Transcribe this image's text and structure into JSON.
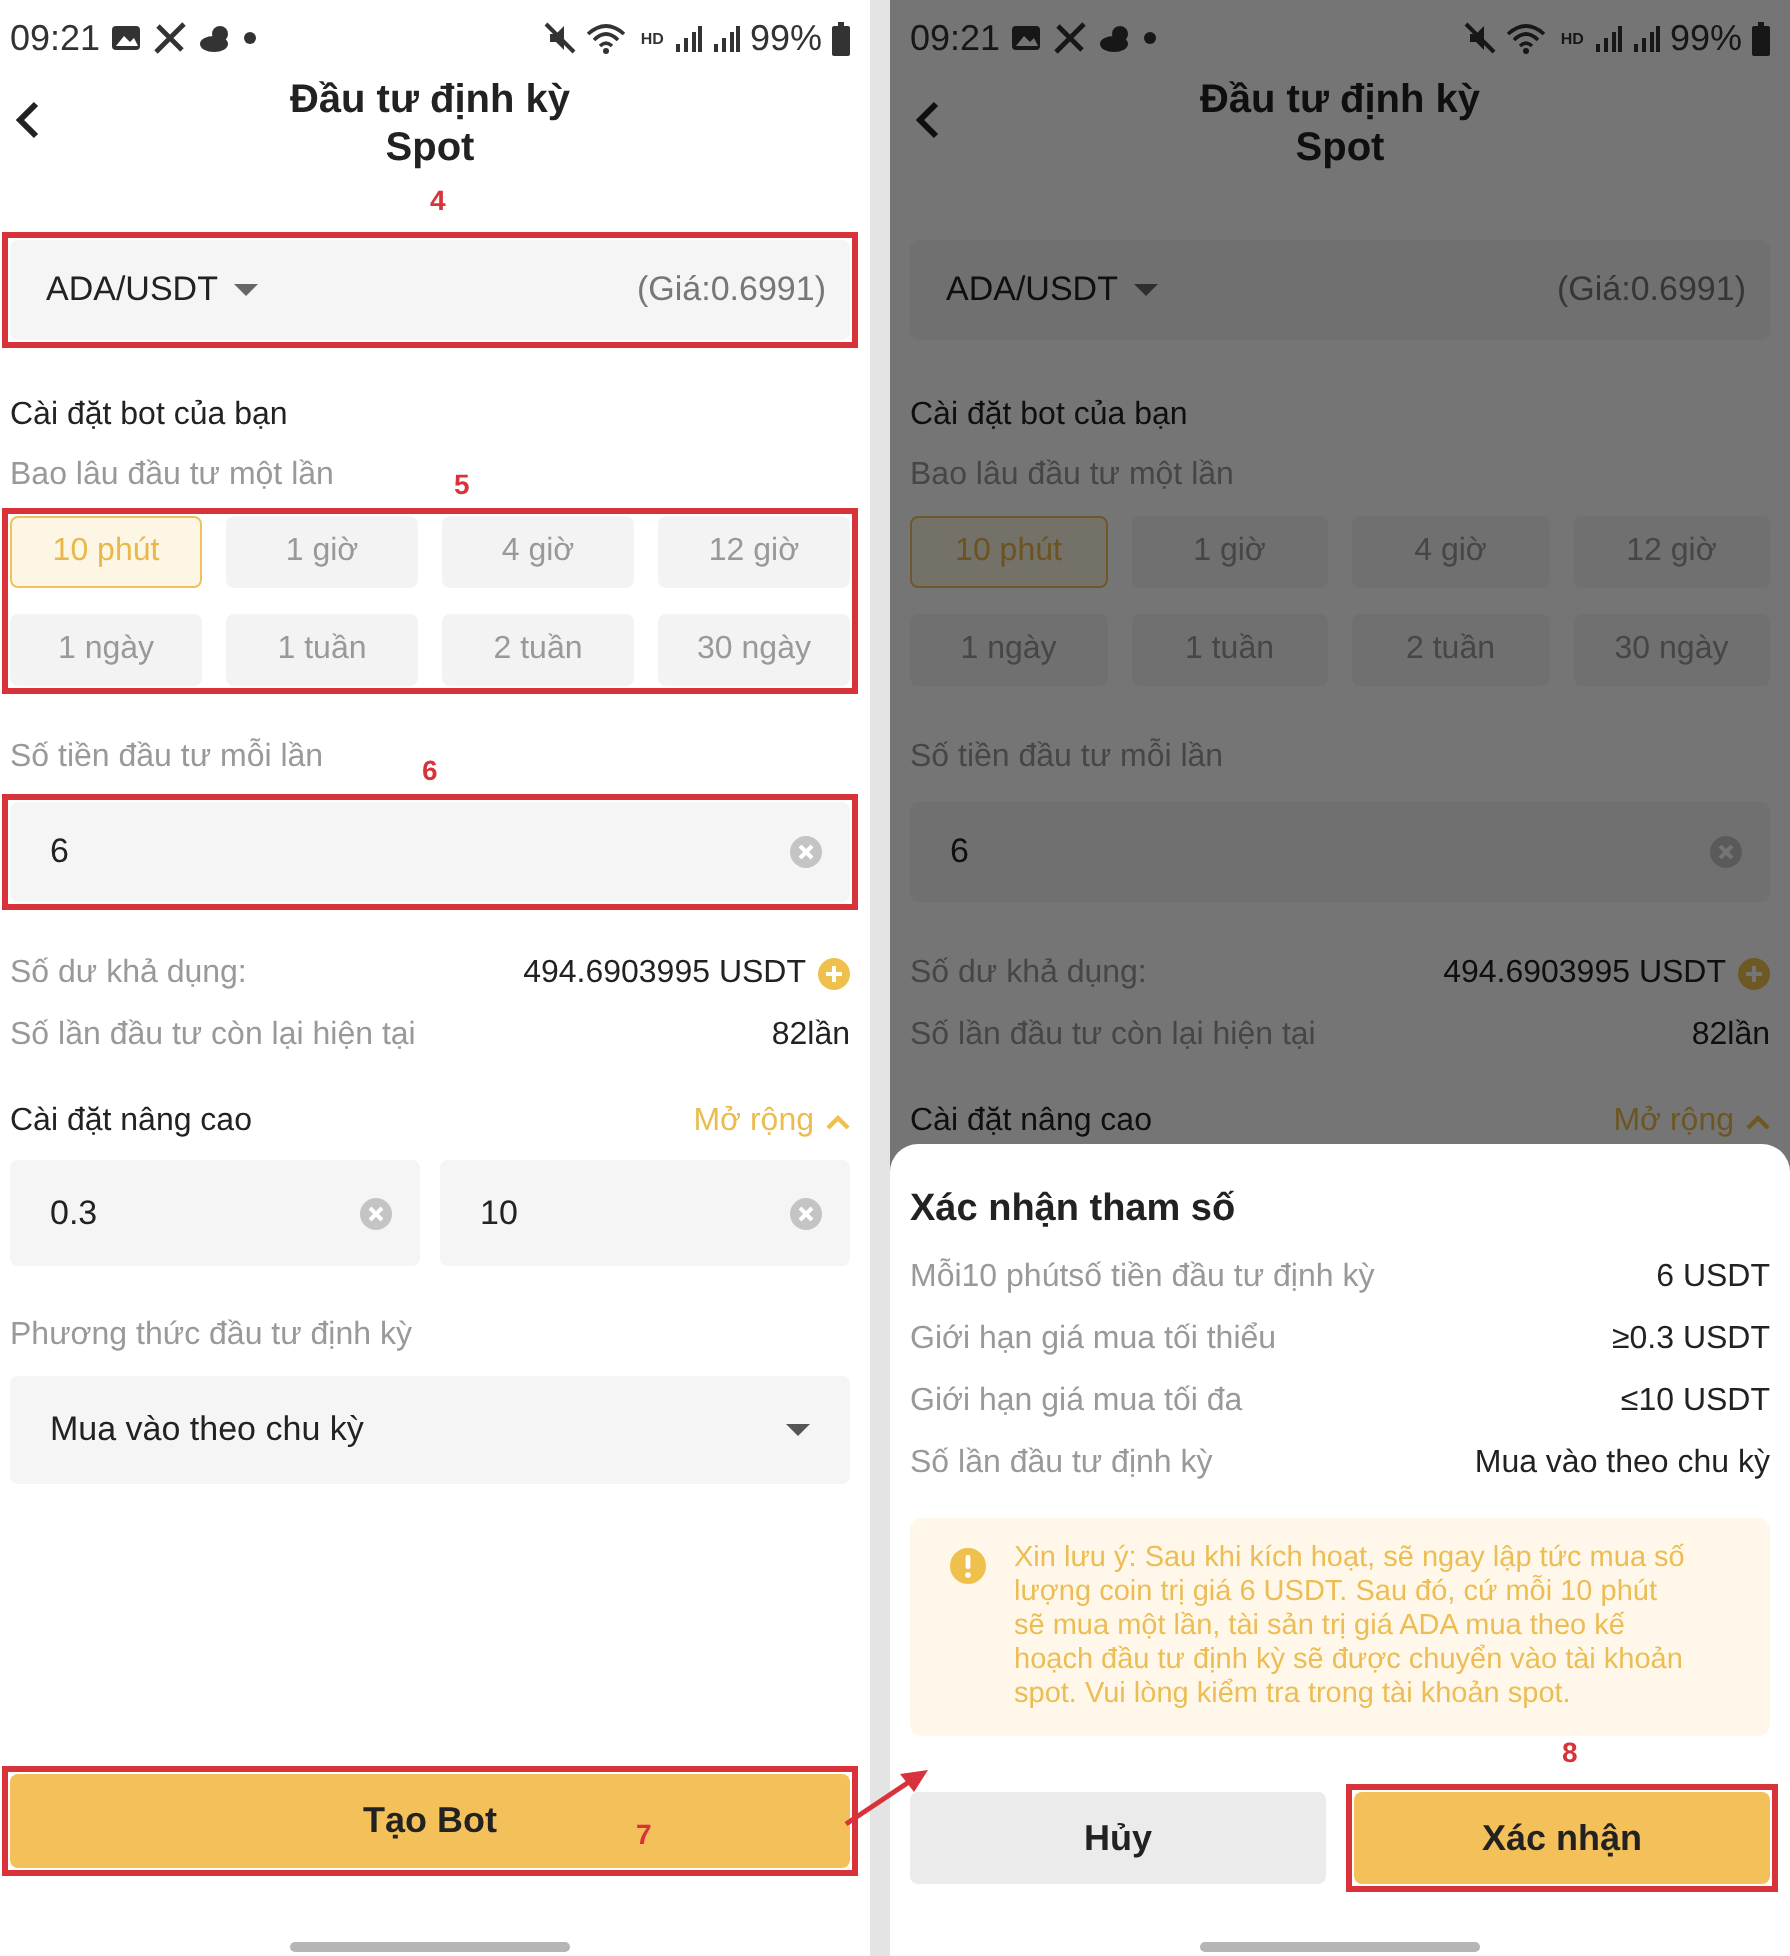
{
  "screens": [
    {
      "status_bar": {
        "time": "09:21",
        "network": "HD",
        "battery": "99%"
      },
      "header": {
        "title": "Đầu tư định kỳ",
        "subtitle": "Spot"
      },
      "pair": {
        "symbol": "ADA/USDT",
        "price": "(Giá:0.6991)",
        "callout": "4"
      },
      "bot_settings": {
        "title": "Cài đặt bot của bạn",
        "interval_label": "Bao lâu đầu tư một lần",
        "callout": "5",
        "intervals": [
          {
            "label": "10 phút",
            "selected": true
          },
          {
            "label": "1 giờ",
            "selected": false
          },
          {
            "label": "4 giờ",
            "selected": false
          },
          {
            "label": "12 giờ",
            "selected": false
          },
          {
            "label": "1 ngày",
            "selected": false
          },
          {
            "label": "1 tuần",
            "selected": false
          },
          {
            "label": "2 tuần",
            "selected": false
          },
          {
            "label": "30 ngày",
            "selected": false
          }
        ]
      },
      "amount": {
        "label": "Số tiền đầu tư mỗi lần",
        "value": "6",
        "callout": "6"
      },
      "balance": {
        "label": "Số dư khả dụng:",
        "value": "494.6903995 USDT"
      },
      "remaining": {
        "label": "Số lần đầu tư còn lại hiện tại",
        "value": "82lần"
      },
      "advanced": {
        "title": "Cài đặt nâng cao",
        "toggle": "Mở rộng",
        "expanded": true,
        "fields": [
          "0.3",
          "10"
        ]
      },
      "method": {
        "label": "Phương thức đầu tư định kỳ",
        "value": "Mua vào theo chu kỳ"
      },
      "create_button": {
        "label": "Tạo Bot",
        "callout": "7"
      }
    },
    {
      "status_bar": {
        "time": "09:21",
        "network": "HD",
        "battery": "99%"
      },
      "header": {
        "title": "Đầu tư định kỳ",
        "subtitle": "Spot"
      },
      "pair": {
        "symbol": "ADA/USDT",
        "price": "(Giá:0.6991)"
      },
      "bot_settings": {
        "title": "Cài đặt bot của bạn",
        "interval_label": "Bao lâu đầu tư một lần",
        "intervals": [
          {
            "label": "10 phút",
            "selected": true
          },
          {
            "label": "1 giờ",
            "selected": false
          },
          {
            "label": "4 giờ",
            "selected": false
          },
          {
            "label": "12 giờ",
            "selected": false
          },
          {
            "label": "1 ngày",
            "selected": false
          },
          {
            "label": "1 tuần",
            "selected": false
          },
          {
            "label": "2 tuần",
            "selected": false
          },
          {
            "label": "30 ngày",
            "selected": false
          }
        ]
      },
      "amount": {
        "label": "Số tiền đầu tư mỗi lần",
        "value": "6"
      },
      "balance": {
        "label": "Số dư khả dụng:",
        "value": "494.6903995 USDT"
      },
      "remaining": {
        "label": "Số lần đầu tư còn lại hiện tại",
        "value": "82lần"
      },
      "advanced": {
        "title": "Cài đặt nâng cao",
        "toggle": "Mở rộng",
        "expanded": true
      },
      "dialog": {
        "title": "Xác nhận tham số",
        "rows": [
          {
            "label": "Mỗi10 phútsố tiền đầu tư định kỳ",
            "value": "6 USDT"
          },
          {
            "label": "Giới hạn giá mua tối thiểu",
            "value": "≥0.3 USDT"
          },
          {
            "label": "Giới hạn giá mua tối đa",
            "value": "≤10 USDT"
          },
          {
            "label": "Số lần đầu tư định kỳ",
            "value": "Mua vào theo chu kỳ"
          }
        ],
        "notice": "Xin lưu ý: Sau khi kích hoạt, sẽ ngay lập tức mua số lượng coin trị giá 6 USDT. Sau đó, cứ mỗi 10 phút sẽ mua một lần, tài sản trị giá ADA mua theo kế hoạch đầu tư định kỳ sẽ được chuyển vào tài khoản spot. Vui lòng kiểm tra trong tài khoản spot.",
        "buttons": [
          {
            "label": "Hủy",
            "kind": "cancel"
          },
          {
            "label": "Xác nhận",
            "kind": "confirm",
            "callout": "8"
          }
        ]
      }
    }
  ]
}
